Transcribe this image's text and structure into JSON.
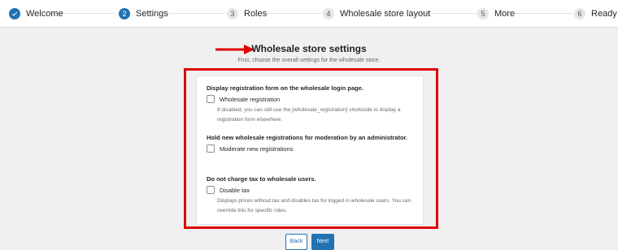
{
  "steps": [
    {
      "num": "1",
      "label": "Welcome",
      "state": "done"
    },
    {
      "num": "2",
      "label": "Settings",
      "state": "active"
    },
    {
      "num": "3",
      "label": "Roles",
      "state": "todo"
    },
    {
      "num": "4",
      "label": "Wholesale store layout",
      "state": "todo"
    },
    {
      "num": "5",
      "label": "More",
      "state": "todo"
    },
    {
      "num": "6",
      "label": "Ready",
      "state": "todo"
    }
  ],
  "page": {
    "title": "Wholesale store settings",
    "subtitle": "First, choose the overall settings for the wholesale store."
  },
  "settings": {
    "registration": {
      "title": "Display registration form on the wholesale login page.",
      "option_label": "Wholesale registration",
      "help": "If disabled, you can still use the [wholesale_registration] shortcode to display a registration form elsewhere."
    },
    "moderation": {
      "title": "Hold new wholesale registrations for moderation by an administrator.",
      "option_label": "Moderate new registrations"
    },
    "tax": {
      "title": "Do not charge tax to wholesale users.",
      "option_label": "Disable tax",
      "help": "Displays prices without tax and disables tax for logged in wholesale users. You can override this for specific roles."
    }
  },
  "buttons": {
    "back": "Back",
    "next": "Next"
  },
  "colors": {
    "accent": "#2271b1",
    "highlight": "#e10000",
    "background": "#f0f0f1"
  }
}
